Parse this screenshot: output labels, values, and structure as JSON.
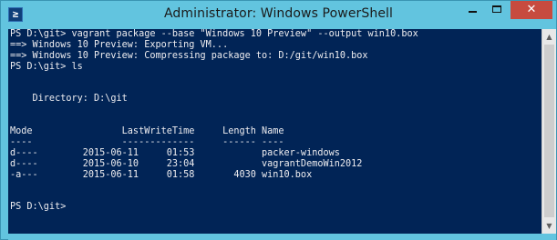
{
  "window": {
    "title": "Administrator: Windows PowerShell",
    "icon_glyph": "≥",
    "close_glyph": "✕"
  },
  "icons": {
    "app": "powershell-icon",
    "minimize": "minimize-icon",
    "maximize": "maximize-icon",
    "close": "close-icon",
    "scroll_up": "scroll-up-arrow-icon",
    "scroll_down": "scroll-down-arrow-icon"
  },
  "colors": {
    "titlebar": "#62c4df",
    "console_background": "#012456",
    "console_text": "#eeedf0",
    "close_button": "#c74b3f"
  },
  "console": {
    "lines": [
      "PS D:\\git> vagrant package --base \"Windows 10 Preview\" --output win10.box",
      "==> Windows 10 Preview: Exporting VM...",
      "==> Windows 10 Preview: Compressing package to: D:/git/win10.box",
      "PS D:\\git> ls",
      "",
      "",
      "    Directory: D:\\git",
      "",
      "",
      "Mode                LastWriteTime     Length Name",
      "----                -------------     ------ ----",
      "d----        2015-06-11     01:53            packer-windows",
      "d----        2015-06-10     23:04            vagrantDemoWin2012",
      "-a---        2015-06-11     01:58       4030 win10.box",
      "",
      "",
      "PS D:\\git>"
    ]
  }
}
